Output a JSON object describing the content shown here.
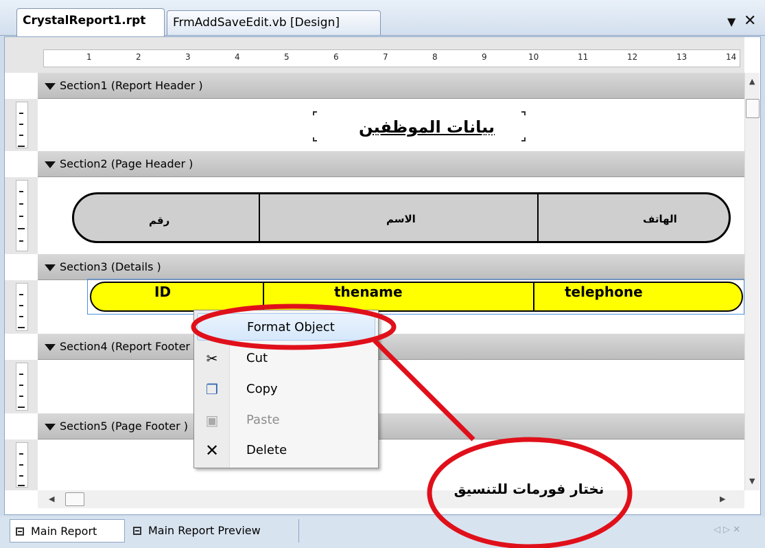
{
  "tabs": {
    "active": "CrystalReport1.rpt",
    "inactive": "FrmAddSaveEdit.vb [Design]",
    "dropdown_glyph": "▼",
    "close_glyph": "✕"
  },
  "ruler": {
    "numbers": [
      "1",
      "2",
      "3",
      "4",
      "5",
      "6",
      "7",
      "8",
      "9",
      "10",
      "11",
      "12",
      "13",
      "14"
    ]
  },
  "sections": [
    {
      "label": "Section1 (Report Header )"
    },
    {
      "label": "Section2 (Page Header )"
    },
    {
      "label": "Section3 (Details )"
    },
    {
      "label": "Section4 (Report Footer )"
    },
    {
      "label": "Section5 (Page Footer )"
    }
  ],
  "report": {
    "title": "بيانات الموظفين",
    "header_columns": [
      "رقم",
      "الاسم",
      "الهاتف"
    ],
    "detail_fields": [
      "ID",
      "thename",
      "telephone"
    ]
  },
  "context_menu": {
    "items": [
      {
        "label": "Format Object",
        "icon": "",
        "highlighted": true
      },
      {
        "label": "Cut",
        "icon": "scissors-icon"
      },
      {
        "label": "Copy",
        "icon": "copy-icon"
      },
      {
        "label": "Paste",
        "icon": "paste-icon",
        "disabled": true
      },
      {
        "label": "Delete",
        "icon": "delete-icon"
      }
    ]
  },
  "bottom_tabs": {
    "main_report": "Main Report",
    "main_report_preview": "Main Report Preview"
  },
  "annotation": {
    "callout_text": "نختار فورمات للتنسيق",
    "color": "#e0101a"
  }
}
